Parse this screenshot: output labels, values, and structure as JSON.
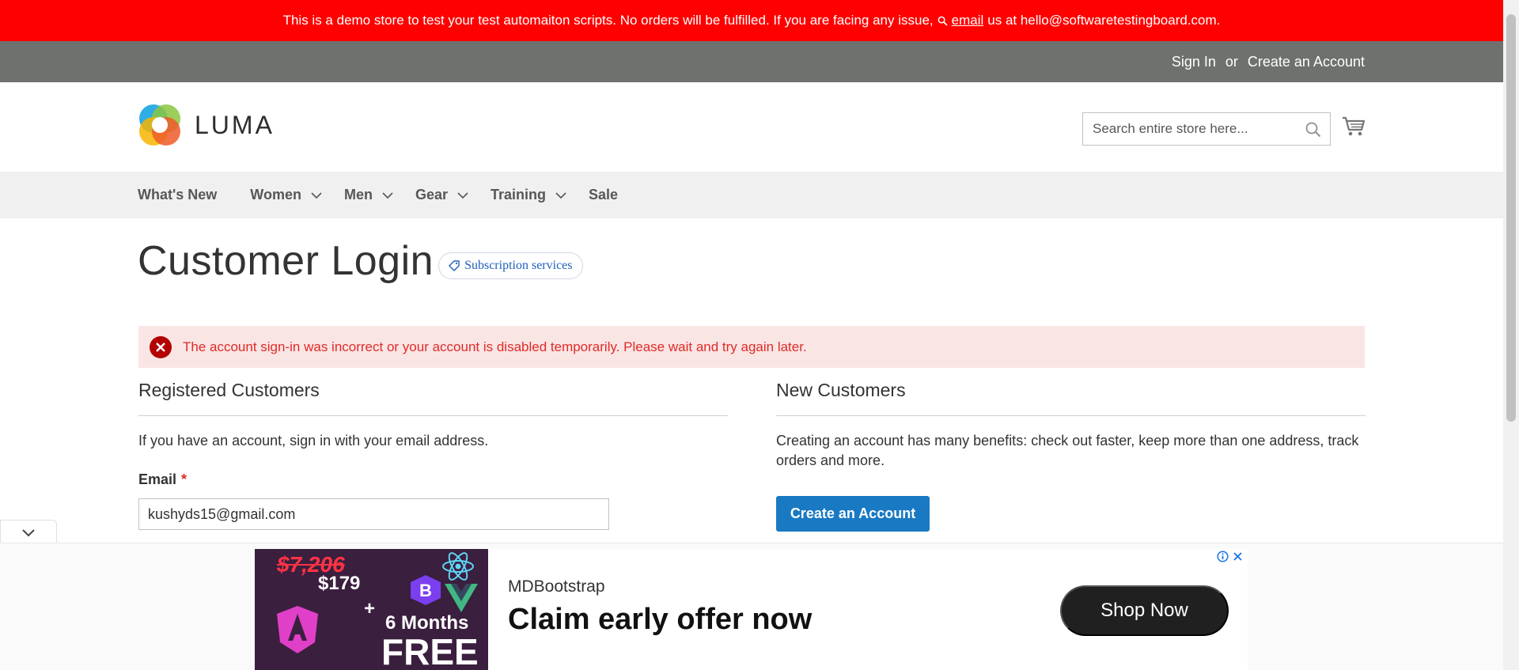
{
  "demo_notice": {
    "text_before": "This is a demo store to test your test automaiton scripts. No orders will be fulfilled. If you are facing any issue,",
    "email_link": "email",
    "text_after": "us at hello@softwaretestingboard.com."
  },
  "panel": {
    "sign_in": "Sign In",
    "or": "or",
    "create_account": "Create an Account"
  },
  "logo": {
    "text": "LUMA"
  },
  "search": {
    "placeholder": "Search entire store here..."
  },
  "nav": {
    "items": [
      {
        "label": "What's New",
        "has_dropdown": false
      },
      {
        "label": "Women",
        "has_dropdown": true
      },
      {
        "label": "Men",
        "has_dropdown": true
      },
      {
        "label": "Gear",
        "has_dropdown": true
      },
      {
        "label": "Training",
        "has_dropdown": true
      },
      {
        "label": "Sale",
        "has_dropdown": false
      }
    ]
  },
  "page": {
    "title": "Customer Login",
    "subscription_badge": "Subscription services"
  },
  "error": {
    "message": "The account sign-in was incorrect or your account is disabled temporarily. Please wait and try again later."
  },
  "registered": {
    "title": "Registered Customers",
    "intro": "If you have an account, sign in with your email address.",
    "email_label": "Email",
    "required_mark": "*",
    "email_value": "kushyds15@gmail.com"
  },
  "new_customers": {
    "title": "New Customers",
    "intro": "Creating an account has many benefits: check out faster, keep more than one address, track orders and more.",
    "button": "Create an Account"
  },
  "ad": {
    "old_price": "$7,206",
    "new_price": "$179",
    "plus": "+",
    "months": "6 Months",
    "free": "FREE",
    "sponsor": "MDBootstrap",
    "headline": "Claim early offer now",
    "cta": "Shop Now"
  },
  "colors": {
    "notice_bg": "#ff0000",
    "panel_bg": "#6e716e",
    "nav_bg": "#f0f0f0",
    "error_bg": "#fae5e5",
    "error_text": "#e02b27",
    "primary_button": "#1979c3"
  }
}
